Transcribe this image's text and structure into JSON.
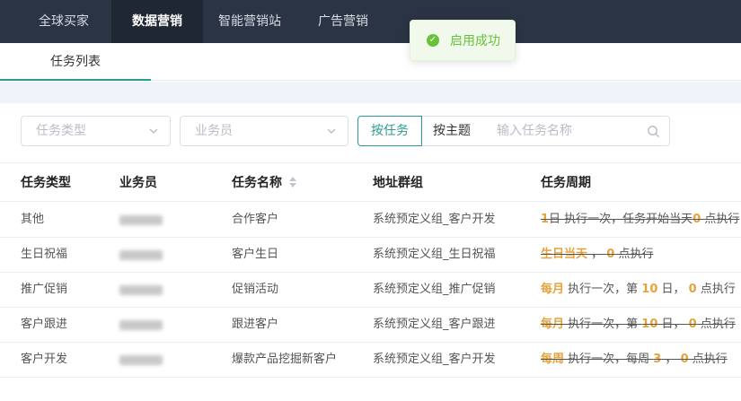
{
  "nav": {
    "items": [
      {
        "label": "全球买家",
        "active": false
      },
      {
        "label": "数据营销",
        "active": true
      },
      {
        "label": "智能营销站",
        "active": false
      },
      {
        "label": "广告营销",
        "active": false
      }
    ]
  },
  "toast": {
    "text": "启用成功",
    "icon": "check-circle-icon",
    "color": "#67c23a"
  },
  "tabs": [
    {
      "label": "任务列表",
      "active": true
    }
  ],
  "filters": {
    "task_type_placeholder": "任务类型",
    "salesperson_placeholder": "业务员",
    "by_task_label": "按任务",
    "by_topic_label": "按主题",
    "search_placeholder": "输入任务名称"
  },
  "table": {
    "headers": [
      "任务类型",
      "业务员",
      "任务名称",
      "地址群组",
      "任务周期"
    ],
    "rows": [
      {
        "type": "其他",
        "name": "合作客户",
        "group": "系统预定义组_客户开发",
        "period": [
          {
            "t": "1",
            "o": true
          },
          {
            "t": "日 执行一次，任务开始当天"
          },
          {
            "t": "0",
            "o": true
          },
          {
            "t": " 点执行"
          }
        ],
        "strike": true
      },
      {
        "type": "生日祝福",
        "name": "客户生日",
        "group": "系统预定义组_生日祝福",
        "period": [
          {
            "t": "生日当天",
            "o": true
          },
          {
            "t": " ， "
          },
          {
            "t": "0",
            "o": true
          },
          {
            "t": " 点执行"
          }
        ],
        "strike": true
      },
      {
        "type": "推广促销",
        "name": "促销活动",
        "group": "系统预定义组_推广促销",
        "period": [
          {
            "t": "每月",
            "o": true
          },
          {
            "t": " 执行一次，第 "
          },
          {
            "t": "10",
            "o": true
          },
          {
            "t": " 日， "
          },
          {
            "t": "0",
            "o": true
          },
          {
            "t": " 点执行"
          }
        ],
        "strike": false
      },
      {
        "type": "客户跟进",
        "name": "跟进客户",
        "group": "系统预定义组_客户跟进",
        "period": [
          {
            "t": "每月",
            "o": true
          },
          {
            "t": " 执行一次，第 "
          },
          {
            "t": "10",
            "o": true
          },
          {
            "t": " 日， "
          },
          {
            "t": "0",
            "o": true
          },
          {
            "t": " 点执行"
          }
        ],
        "strike": true
      },
      {
        "type": "客户开发",
        "name": "爆款产品挖掘新客户",
        "group": "系统预定义组_客户开发",
        "period": [
          {
            "t": "每周",
            "o": true
          },
          {
            "t": " 执行一次，每周 "
          },
          {
            "t": "3",
            "o": true
          },
          {
            "t": " ， "
          },
          {
            "t": "0",
            "o": true
          },
          {
            "t": " 点执行"
          }
        ],
        "strike": true
      }
    ]
  },
  "colors": {
    "accent": "#2a9d8f",
    "highlight": "#e6a23c",
    "nav_bg": "#2b3444"
  }
}
